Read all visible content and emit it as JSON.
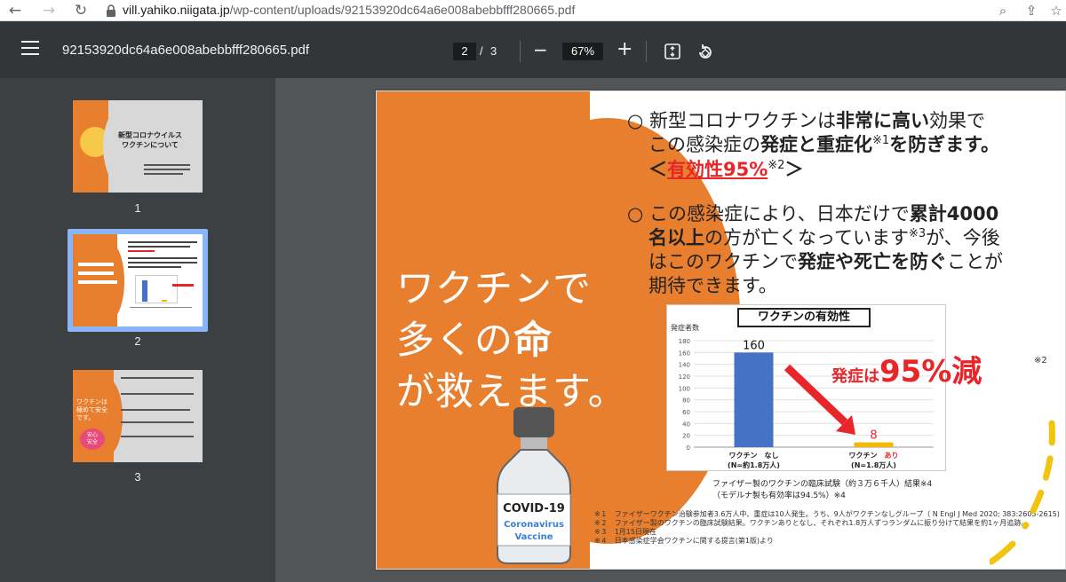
{
  "browser": {
    "url_host": "vill.yahiko.niigata.jp",
    "url_path": "/wp-content/uploads/92153920dc64a6e008abebbfff280665.pdf"
  },
  "toolbar": {
    "file_title": "92153920dc64a6e008abebbfff280665.pdf",
    "current_page": "2",
    "page_separator": "/",
    "total_pages": "3",
    "zoom": "67%"
  },
  "sidebar": {
    "thumbs": [
      {
        "label": "1",
        "title_line1": "新型コロナウイルス",
        "title_line2": "ワクチンについて"
      },
      {
        "label": "2",
        "selected": true
      },
      {
        "label": "3",
        "text1": "ワクチンは",
        "text2": "極めて安全",
        "text3": "です。",
        "badge1": "安心",
        "badge2": "安全"
      }
    ]
  },
  "slide": {
    "slogan_line1": "ワクチンで",
    "slogan_line2a": "多くの",
    "slogan_line2b": "命",
    "slogan_line3": "が救えます。",
    "vial_label1": "COVID-19",
    "vial_label2": "Coronavirus",
    "vial_label3": "Vaccine",
    "b1_l1a": "○ 新型コロナワクチンは",
    "b1_l1b": "非常に高い",
    "b1_l1c": "効果で",
    "b1_l2a": "この感染症の",
    "b1_l2b": "発症と重症化",
    "b1_l2sup": "※1",
    "b1_l2c": "を防ぎます。",
    "b1_l3a": "＜",
    "b1_l3b": "有効性95%",
    "b1_l3sup": "※2",
    "b1_l3c": "＞",
    "b2_l1a": "○ この感染症により、日本だけで",
    "b2_l1b": "累計4000",
    "b2_l2a": "名以上",
    "b2_l2b": "の方が亡くなっています",
    "b2_l2sup": "※3",
    "b2_l2c": "が、今後",
    "b2_l3a": "はこのワクチンで",
    "b2_l3b": "発症や死亡を防ぐ",
    "b2_l3c": "ことが",
    "b2_l4": "期待できます。",
    "reduce_a": "発症は",
    "reduce_b": "95%減",
    "reduce_note": "※2",
    "caption1": "ファイザー製のワクチンの臨床試験（約３万６千人）結果※4",
    "caption2": "（モデルナ製も有効率は94.5%）※4",
    "footnotes": [
      "※１　ファイザーワクチン治験参加者3.6万人中、重症は10人発生。うち、9人がワクチンなしグループ（ N Engl J Med 2020; 383:2603-2615)",
      "※２　ファイザー製のワクチンの臨床試験結果。ワクチンありとなし、それぞれ1.8万人ずつランダムに振り分けて結果を約1ヶ月追跡。",
      "※３　1月15日現在",
      "※４　日本感染症学会ワクチンに関する提言(第1版)より"
    ]
  },
  "chart_data": {
    "type": "bar",
    "title": "ワクチンの有効性",
    "ylabel": "発症者数",
    "ylim": [
      0,
      180
    ],
    "yticks": [
      0,
      20,
      40,
      60,
      80,
      100,
      120,
      140,
      160,
      180
    ],
    "categories": [
      {
        "line1a": "ワクチン　",
        "line1b": "なし",
        "line2": "(N=約1.8万人)"
      },
      {
        "line1a": "ワクチン　",
        "line1b": "あり",
        "line2": "(N=1.8万人)"
      }
    ],
    "values": [
      160,
      8
    ],
    "colors": [
      "#4472c4",
      "#f5b800"
    ]
  }
}
